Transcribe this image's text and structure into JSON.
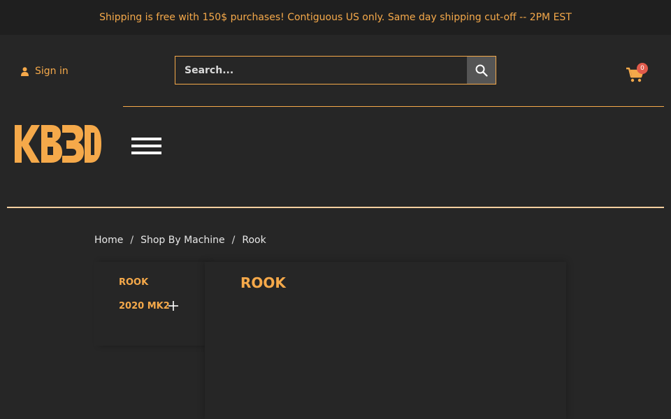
{
  "topbar": {
    "message": "Shipping is free with 150$ purchases! Contiguous US only. Same day shipping cut-off -- 2PM EST"
  },
  "header": {
    "signin_label": "Sign in",
    "search": {
      "placeholder": "Search..."
    },
    "cart": {
      "count": "0"
    }
  },
  "breadcrumb": {
    "items": [
      "Home",
      "Shop By Machine",
      "Rook"
    ],
    "separator": "/"
  },
  "sidebar": {
    "items": [
      "ROOK",
      "2020 MK2"
    ]
  },
  "main": {
    "title": "ROOK"
  },
  "colors": {
    "accent": "#f5a94a",
    "background": "#262626",
    "topbar_background": "#1f1f1f",
    "badge": "#e05a4b"
  },
  "icons": {
    "user": "user-icon",
    "search": "search-icon",
    "cart": "cart-icon",
    "menu": "hamburger-icon",
    "expand": "plus-icon"
  }
}
